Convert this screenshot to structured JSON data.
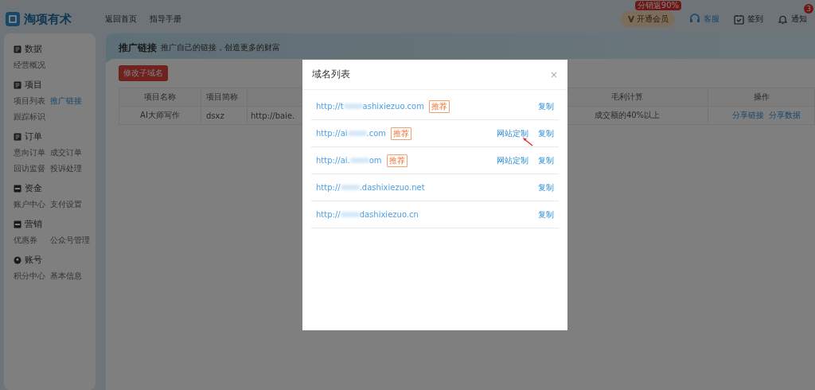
{
  "header": {
    "brand": "淘项有术",
    "nav": [
      "返回首页",
      "指导手册"
    ],
    "vip": {
      "label": "开通会员",
      "badge": "分销返90%"
    },
    "service": "客服",
    "checkin": "签到",
    "notice": {
      "label": "通知",
      "badge": "3"
    }
  },
  "sidebar": {
    "sections": [
      {
        "title": "数据",
        "items": [
          {
            "label": "经营概况",
            "selected": false
          }
        ]
      },
      {
        "title": "项目",
        "items": [
          {
            "label": "项目列表",
            "selected": false
          },
          {
            "label": "推广链接",
            "selected": true
          },
          {
            "label": "跟踪标识",
            "selected": false
          }
        ]
      },
      {
        "title": "订单",
        "items": [
          {
            "label": "意向订单",
            "selected": false
          },
          {
            "label": "成交订单",
            "selected": false
          },
          {
            "label": "回访监督",
            "selected": false
          },
          {
            "label": "投诉处理",
            "selected": false
          }
        ]
      },
      {
        "title": "资金",
        "items": [
          {
            "label": "账户中心",
            "selected": false
          },
          {
            "label": "支付设置",
            "selected": false
          }
        ]
      },
      {
        "title": "营销",
        "items": [
          {
            "label": "优惠券",
            "selected": false
          },
          {
            "label": "公众号管理",
            "selected": false
          }
        ]
      },
      {
        "title": "账号",
        "items": [
          {
            "label": "积分中心",
            "selected": false
          },
          {
            "label": "基本信息",
            "selected": false
          }
        ]
      }
    ]
  },
  "page": {
    "title": "推广链接",
    "subtitle": "推广自己的链接，创造更多的财富",
    "button": "修改子域名",
    "table": {
      "columns": [
        "项目名称",
        "项目简称",
        "",
        "毛利计算",
        "操作"
      ],
      "rows": [
        {
          "cells": [
            "AI大师写作",
            "dsxz",
            "http://baie.",
            "成交额的40%以上"
          ],
          "actions": [
            "分享链接",
            "分享数据"
          ]
        }
      ]
    }
  },
  "modal": {
    "title": "域名列表",
    "close": "×",
    "rows": [
      {
        "url_start": "http://t",
        "url_end": "ashixiezuo.com",
        "tag": "推荐",
        "actions": [
          "复制"
        ],
        "arrow": false
      },
      {
        "url_start": "http://ai",
        "url_end": ".com",
        "tag": "推荐",
        "actions": [
          "网站定制",
          "复制"
        ],
        "arrow": true
      },
      {
        "url_start": "http://ai.",
        "url_end": "om",
        "tag": "推荐",
        "actions": [
          "网站定制",
          "复制"
        ],
        "arrow": false
      },
      {
        "url_start": "http://",
        "url_end": ".dashixiezuo.net",
        "tag": "",
        "actions": [
          "复制"
        ],
        "arrow": false
      },
      {
        "url_start": "http://",
        "url_end": "dashixiezuo.cn",
        "tag": "",
        "actions": [
          "复制"
        ],
        "arrow": false
      }
    ]
  }
}
